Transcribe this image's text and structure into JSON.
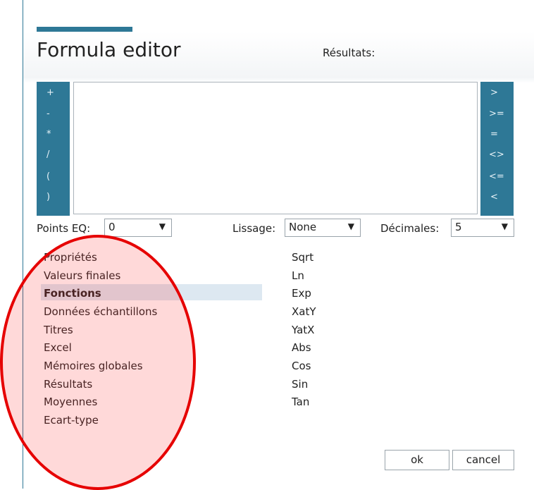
{
  "dialog": {
    "title": "Formula editor",
    "results_label": "Résultats:"
  },
  "operators_left": [
    "+",
    "-",
    "*",
    "/",
    "(",
    ")"
  ],
  "operators_right": [
    ">",
    ">=",
    "=",
    "<>",
    "<=",
    "<"
  ],
  "editor": {
    "value": ""
  },
  "options": {
    "points_eq": {
      "label": "Points EQ:",
      "value": "0"
    },
    "lissage": {
      "label": "Lissage:",
      "value": "None"
    },
    "decimales": {
      "label": "Décimales:",
      "value": "5"
    }
  },
  "categories": [
    "Propriétés",
    "Valeurs finales",
    "Fonctions",
    "Données échantillons",
    "Titres",
    "Excel",
    "Mémoires globales",
    "Résultats",
    "Moyennes",
    "Ecart-type"
  ],
  "selected_category": "Fonctions",
  "functions": [
    "Sqrt",
    "Ln",
    "Exp",
    "XatY",
    "YatX",
    "Abs",
    "Cos",
    "Sin",
    "Tan"
  ],
  "buttons": {
    "ok": "ok",
    "cancel": "cancel"
  },
  "colors": {
    "accent": "#2e7896",
    "annotation": "#e60000",
    "selection": "#dde8f1"
  }
}
